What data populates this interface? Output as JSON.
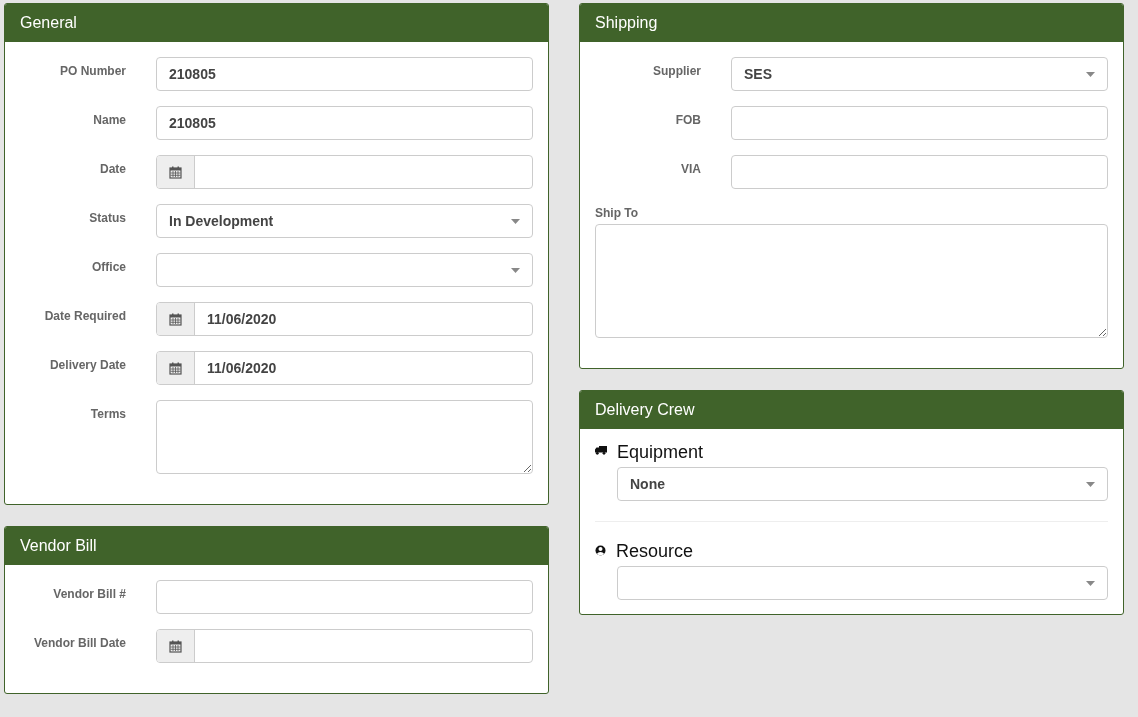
{
  "columns": [
    {
      "panels": [
        {
          "title": "General",
          "kind": "form",
          "fields": [
            {
              "label": "PO Number",
              "kind": "text",
              "value": "210805"
            },
            {
              "label": "Name",
              "kind": "text",
              "value": "210805"
            },
            {
              "label": "Date",
              "kind": "date"
            },
            {
              "label": "Status",
              "kind": "select",
              "value": "In Development"
            },
            {
              "label": "Office",
              "kind": "select"
            },
            {
              "label": "Date Required",
              "kind": "date",
              "value": "11/06/2020"
            },
            {
              "label": "Delivery Date",
              "kind": "date",
              "value": "11/06/2020"
            },
            {
              "label": "Terms",
              "kind": "textarea"
            }
          ]
        },
        {
          "title": "Vendor Bill",
          "kind": "form",
          "fields": [
            {
              "label": "Vendor Bill #",
              "kind": "text"
            },
            {
              "label": "Vendor Bill Date",
              "kind": "date"
            }
          ]
        }
      ]
    },
    {
      "panels": [
        {
          "title": "Shipping",
          "kind": "form",
          "fields": [
            {
              "label": "Supplier",
              "kind": "select",
              "value": "SES"
            },
            {
              "label": "FOB",
              "kind": "text"
            },
            {
              "label": "VIA",
              "kind": "text"
            },
            {
              "label": "Ship To",
              "kind": "stacked_textarea"
            }
          ]
        },
        {
          "title": "Delivery Crew",
          "kind": "crew",
          "fields": [
            {
              "label": "Equipment",
              "kind": "select",
              "value": "None"
            },
            {
              "label": "Resource",
              "kind": "select"
            }
          ]
        }
      ]
    }
  ]
}
